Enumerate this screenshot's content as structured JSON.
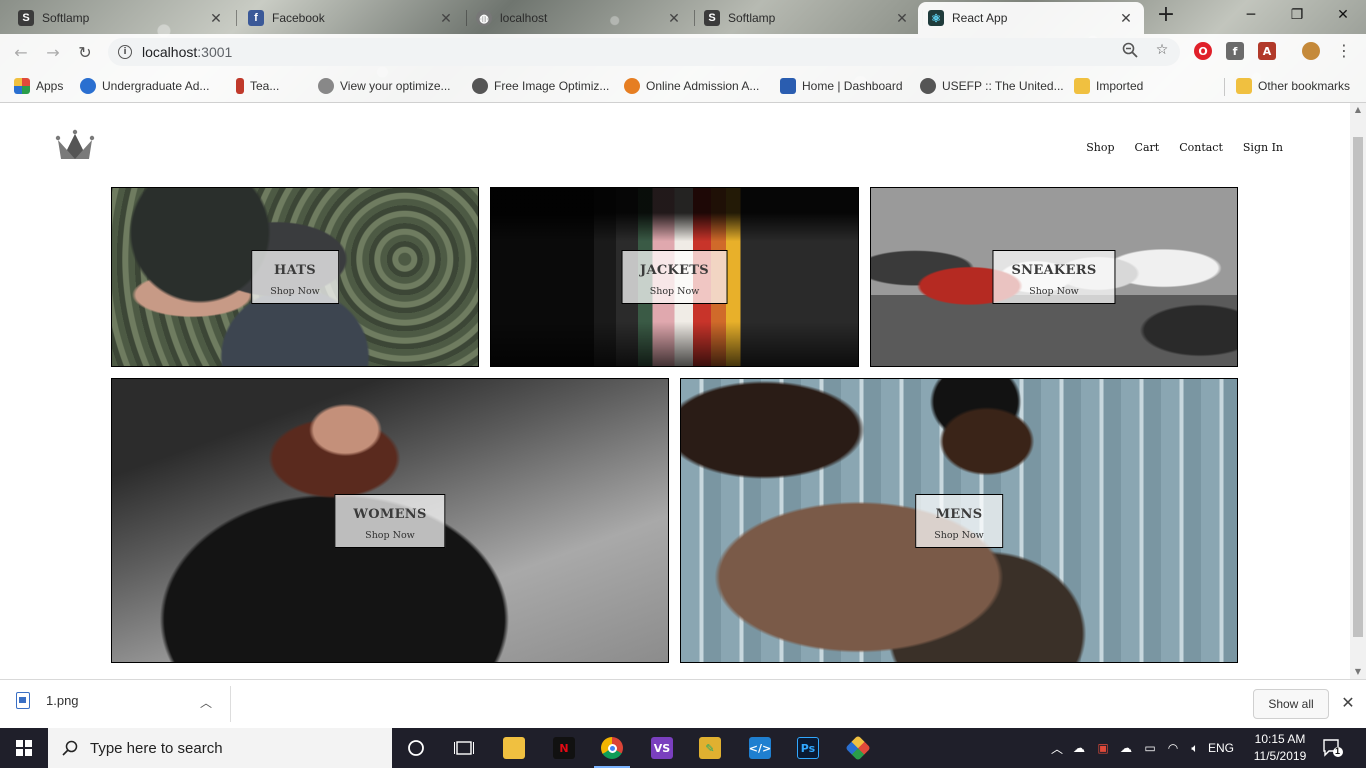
{
  "browser": {
    "tabs": [
      {
        "title": "Softlamp",
        "favicon": "S",
        "fav_color": "#3b3b3b",
        "active": false
      },
      {
        "title": "Facebook",
        "favicon": "f",
        "fav_color": "#3b5998",
        "active": false
      },
      {
        "title": "localhost",
        "favicon": "globe",
        "fav_color": "#666666",
        "active": false
      },
      {
        "title": "Softlamp",
        "favicon": "S",
        "fav_color": "#3b3b3b",
        "active": false
      },
      {
        "title": "React App",
        "favicon": "react",
        "fav_color": "#1f3b3b",
        "active": true
      }
    ],
    "new_tab": "+",
    "url_host": "localhost",
    "url_port": ":3001",
    "bookmarks": [
      {
        "label": "Apps",
        "color": "#e04a3a"
      },
      {
        "label": "Undergraduate Ad...",
        "color": "#2a6fd0"
      },
      {
        "label": "Tea...",
        "color": "#c0392b"
      },
      {
        "label": "View your optimize...",
        "color": "#888888"
      },
      {
        "label": "Free Image Optimiz...",
        "color": "#555555"
      },
      {
        "label": "Online Admission A...",
        "color": "#e67e22"
      },
      {
        "label": "Home | Dashboard",
        "color": "#2a5db0"
      },
      {
        "label": "USEFP :: The United...",
        "color": "#555555"
      },
      {
        "label": "Imported",
        "color": "#f0c040"
      },
      {
        "label": "Other bookmarks",
        "color": "#f0c040"
      }
    ]
  },
  "site": {
    "nav": [
      "Shop",
      "Cart",
      "Contact",
      "Sign In"
    ],
    "categories": [
      {
        "title": "HATS",
        "subtitle": "Shop Now"
      },
      {
        "title": "JACKETS",
        "subtitle": "Shop Now"
      },
      {
        "title": "SNEAKERS",
        "subtitle": "Shop Now"
      },
      {
        "title": "WOMENS",
        "subtitle": "Shop Now"
      },
      {
        "title": "MENS",
        "subtitle": "Shop Now"
      }
    ]
  },
  "downloads": {
    "file": "1.png",
    "show_all": "Show all"
  },
  "taskbar": {
    "search_placeholder": "Type here to search",
    "language": "ENG",
    "time": "10:15 AM",
    "date": "11/5/2019",
    "notification_count": "1"
  }
}
